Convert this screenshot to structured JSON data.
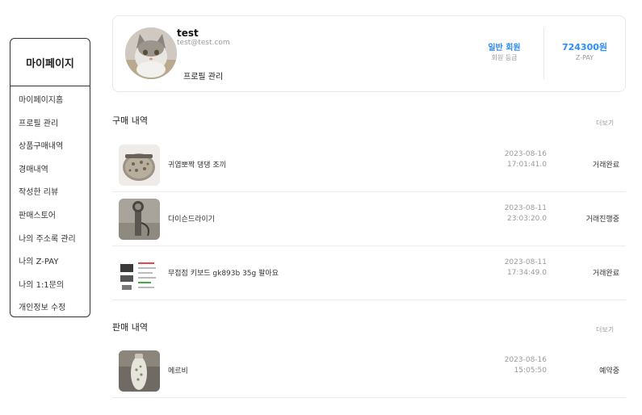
{
  "sidebar": {
    "title": "마이페이지",
    "items": [
      {
        "label": "마이페이지홈"
      },
      {
        "label": "프로필 관리"
      },
      {
        "label": "상품구매내역"
      },
      {
        "label": "경매내역"
      },
      {
        "label": "작성한 리뷰"
      },
      {
        "label": "판매스토어"
      },
      {
        "label": "나의 주소록 관리"
      },
      {
        "label": "나의 Z-PAY"
      },
      {
        "label": "나의 1:1문의"
      },
      {
        "label": "개인정보 수정"
      }
    ]
  },
  "profile": {
    "username": "test",
    "email": "test@test.com",
    "manage_link": "프로필 관리",
    "grade_value": "일반 회원",
    "grade_label": "회원 등급",
    "pay_value": "724300원",
    "pay_label": "Z-PAY",
    "accent_color": "#2a8dfb"
  },
  "purchase": {
    "title": "구매 내역",
    "more": "더보기",
    "items": [
      {
        "name": "귀엽뽀짝 댕댕 조끼",
        "date": "2023-08-16",
        "time": "17:01:41.0",
        "status": "거래완료"
      },
      {
        "name": "다이슨드라이기",
        "date": "2023-08-11",
        "time": "23:03:20.0",
        "status": "거래진행중"
      },
      {
        "name": "무접점 키보드 gk893b 35g 팔아요",
        "date": "2023-08-11",
        "time": "17:34:49.0",
        "status": "거래완료"
      }
    ]
  },
  "sales": {
    "title": "판매 내역",
    "more": "더보기",
    "items": [
      {
        "name": "메르비",
        "date": "2023-08-16",
        "time": "15:05:50",
        "status": "예약중"
      }
    ]
  }
}
